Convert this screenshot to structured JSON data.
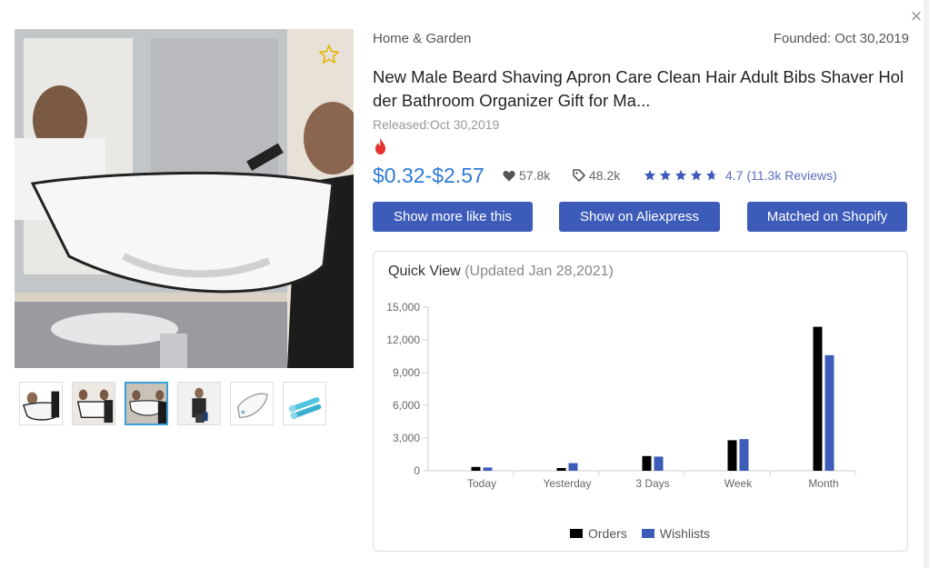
{
  "close_label": "×",
  "product": {
    "category": "Home & Garden",
    "founded": "Founded: Oct 30,2019",
    "title": "New Male Beard Shaving Apron Care Clean Hair Adult Bibs Shaver Holder Bathroom Organizer Gift for Ma...",
    "released": "Released:Oct 30,2019",
    "price": "$0.32-$2.57",
    "likes": "57.8k",
    "orders": "48.2k",
    "rating": "4.7",
    "rating_value": 4.7,
    "reviews": "(11.3k Reviews)"
  },
  "buttons": {
    "more": "Show more like this",
    "aliexpress": "Show on Aliexpress",
    "shopify": "Matched on Shopify"
  },
  "quick_view": {
    "title": "Quick View",
    "updated": "(Updated Jan 28,2021)"
  },
  "colors": {
    "accent": "#3d5bb8",
    "price": "#2d7ad6",
    "orders": "#000000",
    "wishlists": "#3d5bb8",
    "star": "#3d5bb8"
  },
  "thumbnails": [
    {
      "name": "apron-front-view"
    },
    {
      "name": "apron-two-men"
    },
    {
      "name": "apron-mirror",
      "active": true
    },
    {
      "name": "man-wearing-apron"
    },
    {
      "name": "folded-apron"
    },
    {
      "name": "suction-cups"
    }
  ],
  "chart_data": {
    "type": "bar",
    "categories": [
      "Today",
      "Yesterday",
      "3 Days",
      "Week",
      "Month"
    ],
    "series": [
      {
        "name": "Orders",
        "values": [
          350,
          250,
          1350,
          2800,
          13200
        ]
      },
      {
        "name": "Wishlists",
        "values": [
          300,
          700,
          1300,
          2900,
          10600
        ]
      }
    ],
    "ylim": [
      0,
      15000
    ],
    "yticks": [
      0,
      3000,
      6000,
      9000,
      12000,
      15000
    ],
    "ytick_labels": [
      "0",
      "3,000",
      "6,000",
      "9,000",
      "12,000",
      "15,000"
    ],
    "legend": "bottom-center"
  }
}
